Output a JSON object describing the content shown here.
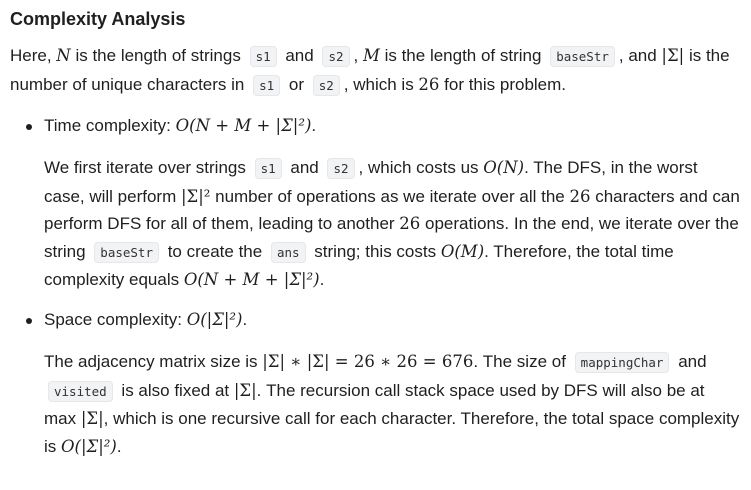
{
  "title": "Complexity Analysis",
  "intro": {
    "t1": "Here, ",
    "N": "N",
    "t2": " is the length of strings ",
    "code_s1": "s1",
    "t3": " and ",
    "code_s2": "s2",
    "t4": ", ",
    "M": "M",
    "t5": " is the length of string ",
    "code_baseStr": "baseStr",
    "t6": ", and ",
    "sigma": "|Σ|",
    "t7": " is the number of unique characters in ",
    "code_s1b": "s1",
    "t8": " or ",
    "code_s2b": "s2",
    "t9": ", which is ",
    "n26": "26",
    "t10": " for this problem."
  },
  "time": {
    "label": "Time complexity: ",
    "formula": "O(N + M + |Σ|²)",
    "end": ".",
    "b1": "We first iterate over strings ",
    "code_s1": "s1",
    "b2": " and ",
    "code_s2": "s2",
    "b3": ", which costs us ",
    "oN": "O(N)",
    "b4": ". The DFS, in the worst case, will perform ",
    "sig2": "|Σ|²",
    "b5": " number of operations as we iterate over all the ",
    "n26a": "26",
    "b6": " characters and can perform DFS for all of them, leading to another ",
    "n26b": "26",
    "b7": " operations. In the end, we iterate over the string ",
    "code_baseStr": "baseStr",
    "b8": " to create the ",
    "code_ans": "ans",
    "b9": " string; this costs ",
    "oM": "O(M)",
    "b10": ". Therefore, the total time complexity equals ",
    "total": "O(N + M + |Σ|²)",
    "b11": "."
  },
  "space": {
    "label": "Space complexity: ",
    "formula": "O(|Σ|²)",
    "end": ".",
    "c1": "The adjacency matrix size is ",
    "calc": "|Σ| ∗ |Σ| = 26 ∗ 26 = 676",
    "c2": ". The size of ",
    "code_mappingChar": "mappingChar",
    "c3": " and ",
    "code_visited": "visited",
    "c4": " is also fixed at ",
    "sigA": "|Σ|",
    "c5": ". The recursion call stack space used by DFS will also be at max ",
    "sigB": "|Σ|",
    "c6": ", which is one recursive call for each character. Therefore, the total space complexity is ",
    "total": "O(|Σ|²)",
    "c7": "."
  }
}
